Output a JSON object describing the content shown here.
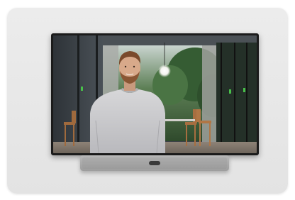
{
  "scene": {
    "description_icon": "video-conferencing-device-icon",
    "colors": {
      "backdrop": "#e6e6e6",
      "bezel": "#1b1b1b",
      "soundbar": "#a8a8a8",
      "sweater": "#cfcfd1",
      "foliage": "#3f6a3a"
    }
  }
}
